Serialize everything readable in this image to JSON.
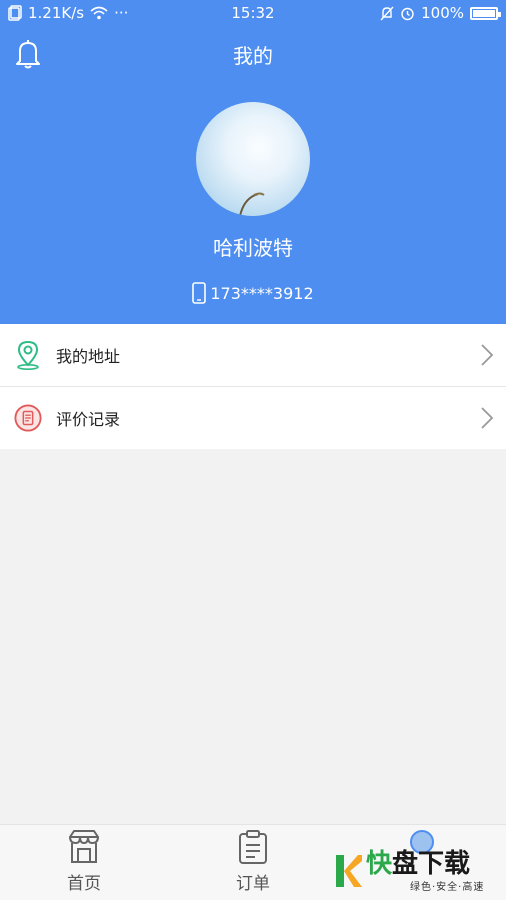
{
  "status_bar": {
    "net_speed": "1.21K/s",
    "more": "···",
    "time": "15:32",
    "battery": "100%"
  },
  "header": {
    "title": "我的",
    "username": "哈利波特",
    "phone": "173****3912"
  },
  "menu": {
    "items": [
      {
        "label": "我的地址",
        "icon": "location-pin-icon",
        "color": "#2ebd85"
      },
      {
        "label": "评价记录",
        "icon": "document-icon",
        "color": "#e05a5a"
      }
    ]
  },
  "tabbar": {
    "tabs": [
      {
        "label": "首页",
        "icon": "store-icon"
      },
      {
        "label": "订单",
        "icon": "clipboard-icon"
      }
    ]
  },
  "watermark": {
    "char1": "快",
    "char2": "盘下载",
    "tagline": "绿色·安全·高速"
  },
  "colors": {
    "header_bg": "#4d8ef0",
    "page_bg": "#f2f2f2"
  }
}
